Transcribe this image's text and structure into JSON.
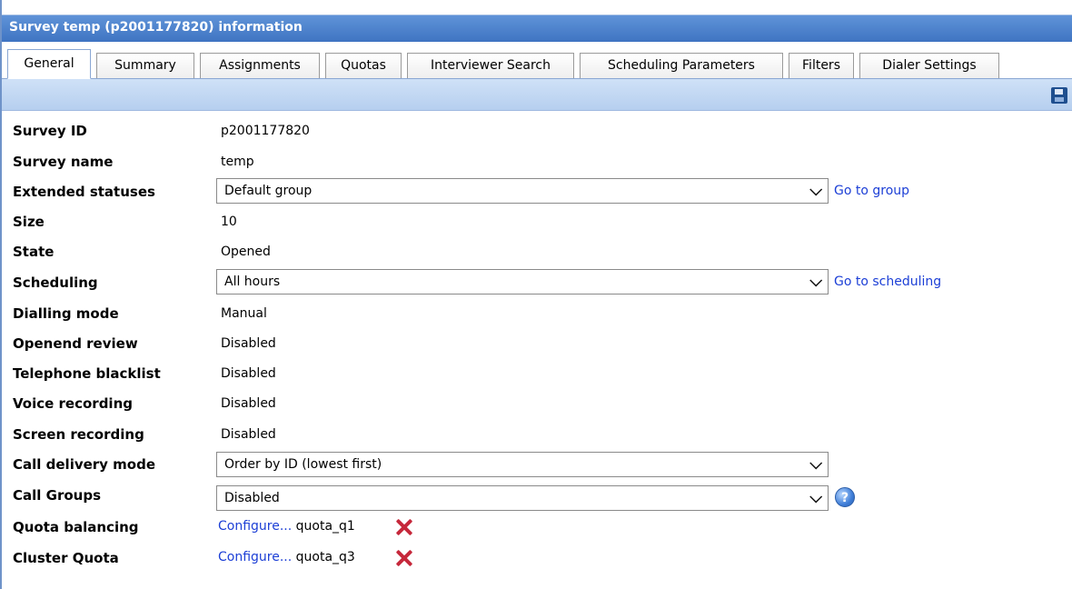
{
  "window": {
    "title": "Survey temp (p2001177820) information"
  },
  "tabs": [
    {
      "label": "General",
      "active": true
    },
    {
      "label": "Summary",
      "active": false
    },
    {
      "label": "Assignments",
      "active": false
    },
    {
      "label": "Quotas",
      "active": false
    },
    {
      "label": "Interviewer Search",
      "active": false
    },
    {
      "label": "Scheduling Parameters",
      "active": false
    },
    {
      "label": "Filters",
      "active": false
    },
    {
      "label": "Dialer Settings",
      "active": false
    }
  ],
  "toolbar": {
    "save_icon": "save-icon"
  },
  "fields": {
    "survey_id": {
      "label": "Survey ID",
      "value": "p2001177820"
    },
    "survey_name": {
      "label": "Survey name",
      "value": "temp"
    },
    "extended_statuses": {
      "label": "Extended statuses",
      "selected": "Default group",
      "link": "Go to group"
    },
    "size": {
      "label": "Size",
      "value": "10"
    },
    "state": {
      "label": "State",
      "value": "Opened"
    },
    "scheduling": {
      "label": "Scheduling",
      "selected": "All hours",
      "link": "Go to scheduling"
    },
    "dialling_mode": {
      "label": "Dialling mode",
      "value": "Manual"
    },
    "openend_review": {
      "label": "Openend review",
      "value": "Disabled"
    },
    "telephone_blacklist": {
      "label": "Telephone blacklist",
      "value": "Disabled"
    },
    "voice_recording": {
      "label": "Voice recording",
      "value": "Disabled"
    },
    "screen_recording": {
      "label": "Screen recording",
      "value": "Disabled"
    },
    "call_delivery_mode": {
      "label": "Call delivery mode",
      "selected": "Order by ID (lowest first)"
    },
    "call_groups": {
      "label": "Call Groups",
      "selected": "Disabled"
    },
    "quota_balancing": {
      "label": "Quota balancing",
      "link": "Configure...",
      "value": "quota_q1"
    },
    "cluster_quota": {
      "label": "Cluster Quota",
      "link": "Configure...",
      "value": "quota_q3"
    }
  },
  "icons": {
    "chevron": "chevron-down-icon",
    "remove": "close-icon",
    "help": "help-icon"
  },
  "colors": {
    "title_bar": "#4a80cc",
    "link": "#1c3fd6",
    "remove_icon": "#c6283b"
  }
}
